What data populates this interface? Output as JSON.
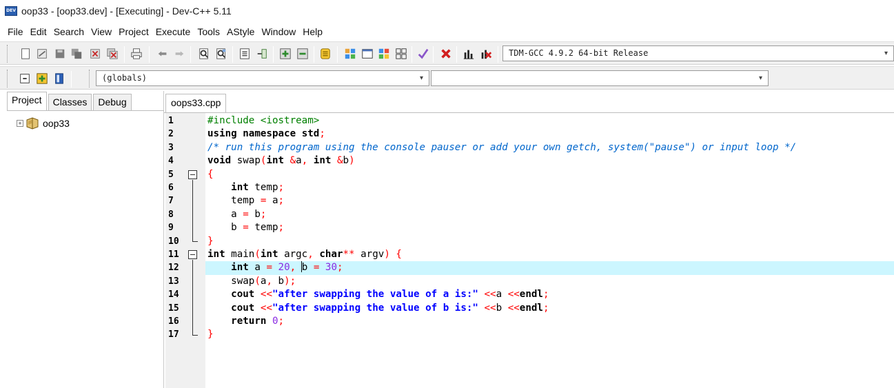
{
  "window": {
    "title": "oop33 - [oop33.dev] - [Executing] - Dev-C++ 5.11",
    "icon_text": "DEV"
  },
  "menu": [
    "File",
    "Edit",
    "Search",
    "View",
    "Project",
    "Execute",
    "Tools",
    "AStyle",
    "Window",
    "Help"
  ],
  "toolbar": {
    "compiler": "TDM-GCC 4.9.2 64-bit Release",
    "scope": "(globals)",
    "members": ""
  },
  "left_panel": {
    "tabs": [
      "Project",
      "Classes",
      "Debug"
    ],
    "active_tab": "Project",
    "tree": {
      "expander": "+",
      "label": "oop33"
    }
  },
  "editor": {
    "tab": "oops33.cpp",
    "current_line": 12,
    "lines": [
      {
        "n": "1",
        "text": "#include <iostream>"
      },
      {
        "n": "2",
        "text": "using namespace std;"
      },
      {
        "n": "3",
        "text": "/* run this program using the console pauser or add your own getch, system(\"pause\") or input loop */"
      },
      {
        "n": "4",
        "text": "void swap(int &a, int &b)"
      },
      {
        "n": "5",
        "text": "{"
      },
      {
        "n": "6",
        "text": "    int temp;"
      },
      {
        "n": "7",
        "text": "    temp = a;"
      },
      {
        "n": "8",
        "text": "    a = b;"
      },
      {
        "n": "9",
        "text": "    b = temp;"
      },
      {
        "n": "10",
        "text": "}"
      },
      {
        "n": "11",
        "text": "int main(int argc, char** argv) {"
      },
      {
        "n": "12",
        "text": "    int a = 20, b = 30;"
      },
      {
        "n": "13",
        "text": "    swap(a, b);"
      },
      {
        "n": "14",
        "text": "    cout <<\"after swapping the value of a is:\" <<a <<endl;"
      },
      {
        "n": "15",
        "text": "    cout <<\"after swapping the value of b is:\" <<b <<endl;"
      },
      {
        "n": "16",
        "text": "    return 0;"
      },
      {
        "n": "17",
        "text": "}"
      }
    ]
  }
}
